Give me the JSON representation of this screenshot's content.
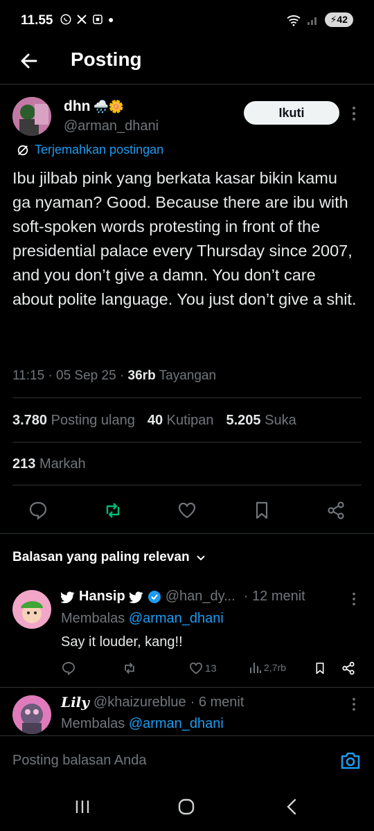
{
  "status": {
    "time": "11.55",
    "battery": "42"
  },
  "header": {
    "title": "Posting"
  },
  "tweet": {
    "author_name": "dhn",
    "author_emoji": "🌧️🌼",
    "handle": "@arman_dhani",
    "follow_label": "Ikuti",
    "translate_label": "Terjemahkan postingan",
    "text": "Ibu jilbab pink yang berkata kasar bikin kamu ga nyaman? Good. Because there are ibu with soft-spoken words protesting in front of the presidential palace every Thursday since 2007, and you don’t give a damn. You don’t care about polite language. You just don’t give a shit.",
    "time": "11:15 · 05 Sep 25 · ",
    "views_count": "36rb",
    "views_label": " Tayangan",
    "stats": {
      "reposts_count": "3.780",
      "reposts_label": "Posting ulang",
      "quotes_count": "40",
      "quotes_label": "Kutipan",
      "likes_count": "5.205",
      "likes_label": "Suka",
      "bookmarks_count": "213",
      "bookmarks_label": "Markah"
    }
  },
  "replies_section": {
    "label": "Balasan yang paling relevan"
  },
  "replies": [
    {
      "name": "Hansip",
      "handle": "@han_dy...",
      "time": "· 12 menit",
      "replying_prefix": "Membalas ",
      "replying_to": "@arman_dhani",
      "text": "Say it louder, kang!!",
      "likes": "13",
      "views": "2,7rb"
    },
    {
      "name": "Lily",
      "handle": "@khaizureblue",
      "time": "· 6 menit",
      "replying_prefix": "Membalas ",
      "replying_to": "@arman_dhani"
    }
  ],
  "composer": {
    "placeholder": "Posting balasan Anda"
  },
  "colors": {
    "accent": "#1d9bf0",
    "repost_green": "#00ba7c",
    "muted": "#71767b",
    "divider": "#2f3336"
  }
}
